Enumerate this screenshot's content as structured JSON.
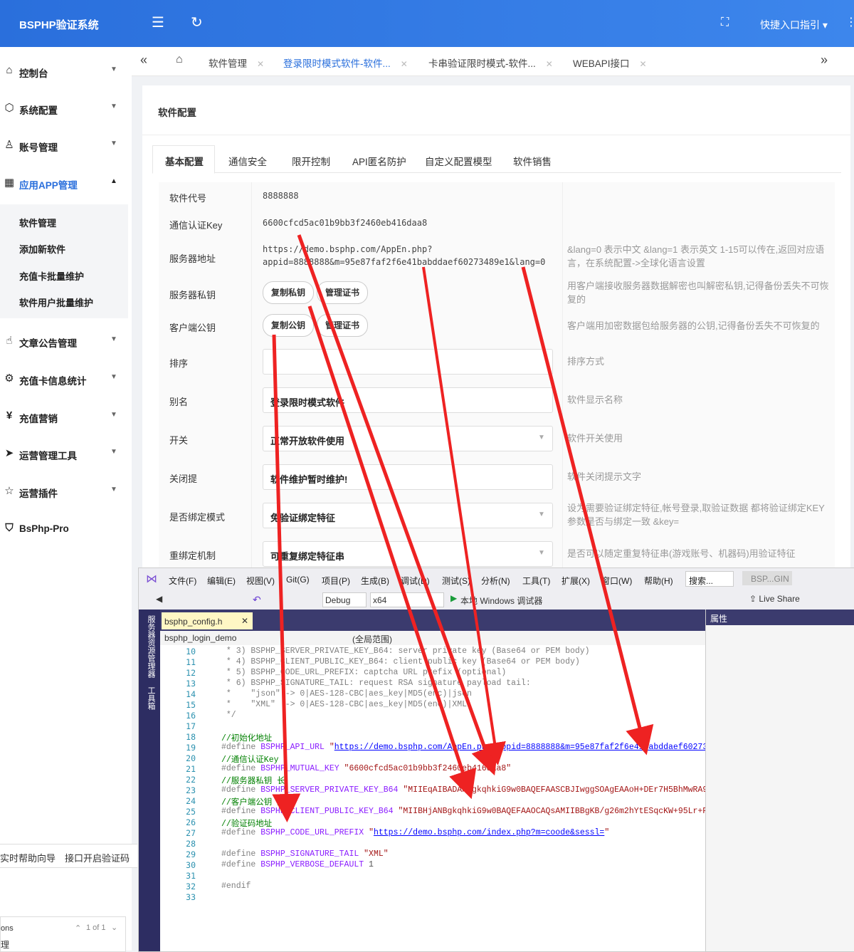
{
  "topbar": {
    "brand": "BSPHP验证系统",
    "quick_entry": "快捷入口指引"
  },
  "sidebar": {
    "items": [
      {
        "label": "控制台",
        "icon": "home-icon"
      },
      {
        "label": "系统配置",
        "icon": "cube-icon"
      },
      {
        "label": "账号管理",
        "icon": "user-icon"
      },
      {
        "label": "应用APP管理",
        "icon": "apps-icon"
      },
      {
        "label": "文章公告管理",
        "icon": "hand-icon"
      },
      {
        "label": "充值卡信息统计",
        "icon": "gear-icon"
      },
      {
        "label": "充值营销",
        "icon": "yen-icon"
      },
      {
        "label": "运营管理工具",
        "icon": "send-icon"
      },
      {
        "label": "运营插件",
        "icon": "star-icon"
      },
      {
        "label": "BsPhp-Pro",
        "icon": "shield-check-icon"
      }
    ],
    "submenu": [
      "软件管理",
      "添加新软件",
      "充值卡批量维护",
      "软件用户批量维护"
    ]
  },
  "tabs": [
    {
      "label": "软件管理"
    },
    {
      "label": "登录限时模式软件-软件..."
    },
    {
      "label": "卡串验证限时模式-软件..."
    },
    {
      "label": "WEBAPI接口"
    }
  ],
  "card": {
    "title": "软件配置",
    "inner_tabs": [
      "基本配置",
      "通信安全",
      "限开控制",
      "API匿名防护",
      "自定义配置模型",
      "软件销售"
    ]
  },
  "config": {
    "software_code": {
      "label": "软件代号",
      "value": "8888888"
    },
    "comm_key": {
      "label": "通信认证Key",
      "value": "6600cfcd5ac01b9bb3f2460eb416daa8"
    },
    "server_addr": {
      "label": "服务器地址",
      "value_line1": "https://demo.bsphp.com/AppEn.php?",
      "value_line2": "appid=8888888&m=95e87faf2f6e41babddaef60273489e1&lang=0",
      "hint": "&lang=0 表示中文 &lang=1 表示英文 1-15可以传在,返回对应语言，在系统配置->全球化语言设置"
    },
    "server_private": {
      "label": "服务器私钥",
      "btn1": "复制私钥",
      "btn2": "管理证书",
      "hint": "用客户端接收服务器数据解密也叫解密私钥,记得备份丢失不可恢复的"
    },
    "client_public": {
      "label": "客户端公钥",
      "btn1": "复制公钥",
      "btn2": "管理证书",
      "hint": "客户端用加密数据包给服务器的公钥,记得备份丢失不可恢复的"
    },
    "sort": {
      "label": "排序",
      "value": "",
      "hint": "排序方式"
    },
    "alias": {
      "label": "别名",
      "value": "登录限时模式软件",
      "hint": "软件显示名称"
    },
    "switch": {
      "label": "开关",
      "value": "正常开放软件使用",
      "hint": "软件开关使用"
    },
    "close_tip": {
      "label": "关闭提",
      "value": "软件维护暂时维护!",
      "hint": "软件关闭提示文字"
    },
    "bind_mode": {
      "label": "是否绑定模式",
      "value": "免验证绑定特征",
      "hint": "设为需要验证绑定特征,帐号登录,取验证数据 都将验证绑定KEY 参数是否与绑定一致 &key="
    },
    "rebind": {
      "label": "重绑定机制",
      "value": "可重复绑定特征串",
      "hint": "是否可以随定重复特征串(游戏账号、机器码)用验证特征"
    }
  },
  "help": {
    "left": "实时帮助向导",
    "right": "接口开启验证码",
    "pager": "1 of 1",
    "ons": "ons"
  },
  "vs": {
    "menu": [
      "文件(F)",
      "编辑(E)",
      "视图(V)",
      "Git(G)",
      "项目(P)",
      "生成(B)",
      "调试(D)",
      "测试(S)",
      "分析(N)",
      "工具(T)",
      "扩展(X)",
      "窗口(W)",
      "帮助(H)"
    ],
    "search": "搜索...",
    "solution": "BSP...GIN",
    "config": "Debug",
    "platform": "x64",
    "run_target": "本地 Windows 调试器",
    "live_share": "Live Share",
    "doc_tab": "bsphp_config.h",
    "nav_project": "bsphp_login_demo",
    "nav_scope": "(全局范围)",
    "props_title": "属性",
    "side_labels": [
      "服务器资源管理器",
      "工具箱"
    ],
    "lines": [
      {
        "n": "10",
        "t": " * 3) BSPHP_SERVER_PRIVATE_KEY_B64: server private key (Base64 or PEM body)"
      },
      {
        "n": "11",
        "t": " * 4) BSPHP_CLIENT_PUBLIC_KEY_B64: client public key (Base64 or PEM body)"
      },
      {
        "n": "12",
        "t": " * 5) BSPHP_CODE_URL_PREFIX: captcha URL prefix (optional)"
      },
      {
        "n": "13",
        "t": " * 6) BSPHP_SIGNATURE_TAIL: request RSA signature payload tail:"
      },
      {
        "n": "14",
        "t": " *    \"json\" -> 0|AES-128-CBC|aes_key|MD5(enc)|json"
      },
      {
        "n": "15",
        "t": " *    \"XML\"  -> 0|AES-128-CBC|aes_key|MD5(enc)|XML"
      },
      {
        "n": "16",
        "t": " */"
      },
      {
        "n": "17",
        "t": ""
      },
      {
        "n": "18",
        "t": "//初始化地址"
      },
      {
        "n": "19",
        "t": "#define BSPHP_API_URL \"https://demo.bsphp.com/AppEn.php?appid=8888888&m=95e87faf2f6e41babddaef602734"
      },
      {
        "n": "20",
        "t": "//通信认证Key"
      },
      {
        "n": "21",
        "t": "#define BSPHP_MUTUAL_KEY \"6600cfcd5ac01b9bb3f2460eb416daa8\""
      },
      {
        "n": "22",
        "t": "//服务器私钥 长"
      },
      {
        "n": "23",
        "t": "#define BSPHP_SERVER_PRIVATE_KEY_B64 \"MIIEqAIBADANBgkqhkiG9w0BAQEFAASCBJIwggSOAgEAAoH+DEr7H5BhMwRA9Z"
      },
      {
        "n": "24",
        "t": "//客户端公钥 短"
      },
      {
        "n": "25",
        "t": "#define BSPHP_CLIENT_PUBLIC_KEY_B64 \"MIIBHjANBgkqhkiG9w0BAQEFAAOCAQsAMIIBBgKB/g26m2hYtESqcKW+95Lr+Pf"
      },
      {
        "n": "26",
        "t": "//验证码地址"
      },
      {
        "n": "27",
        "t": "#define BSPHP_CODE_URL_PREFIX \"https://demo.bsphp.com/index.php?m=coode&sessl=\""
      },
      {
        "n": "28",
        "t": ""
      },
      {
        "n": "29",
        "t": "#define BSPHP_SIGNATURE_TAIL \"XML\""
      },
      {
        "n": "30",
        "t": "#define BSPHP_VERBOSE_DEFAULT 1"
      },
      {
        "n": "31",
        "t": ""
      },
      {
        "n": "32",
        "t": "#endif"
      },
      {
        "n": "33",
        "t": ""
      }
    ]
  },
  "colors": {
    "brand": "#2a6fdc",
    "arrow": "#ee2222",
    "vs_chrome": "#2d2d62"
  }
}
